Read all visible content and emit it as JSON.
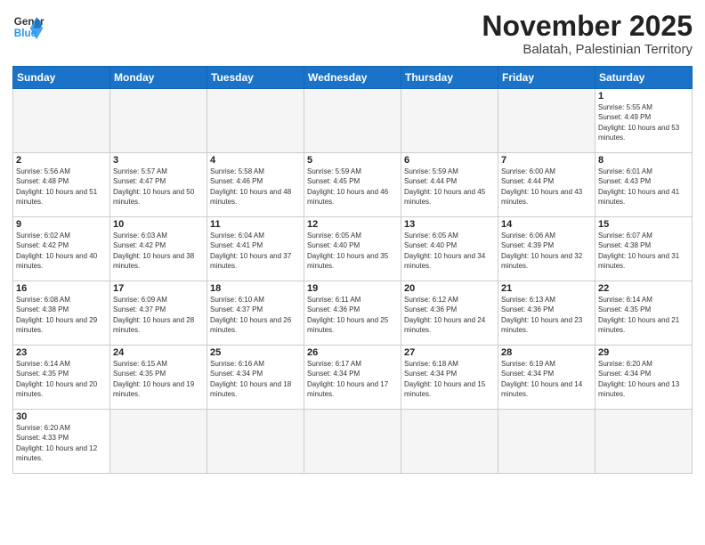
{
  "header": {
    "logo_general": "General",
    "logo_blue": "Blue",
    "month_title": "November 2025",
    "subtitle": "Balatah, Palestinian Territory"
  },
  "weekdays": [
    "Sunday",
    "Monday",
    "Tuesday",
    "Wednesday",
    "Thursday",
    "Friday",
    "Saturday"
  ],
  "days": {
    "1": {
      "sunrise": "5:55 AM",
      "sunset": "4:49 PM",
      "daylight": "10 hours and 53 minutes."
    },
    "2": {
      "sunrise": "5:56 AM",
      "sunset": "4:48 PM",
      "daylight": "10 hours and 51 minutes."
    },
    "3": {
      "sunrise": "5:57 AM",
      "sunset": "4:47 PM",
      "daylight": "10 hours and 50 minutes."
    },
    "4": {
      "sunrise": "5:58 AM",
      "sunset": "4:46 PM",
      "daylight": "10 hours and 48 minutes."
    },
    "5": {
      "sunrise": "5:59 AM",
      "sunset": "4:45 PM",
      "daylight": "10 hours and 46 minutes."
    },
    "6": {
      "sunrise": "5:59 AM",
      "sunset": "4:44 PM",
      "daylight": "10 hours and 45 minutes."
    },
    "7": {
      "sunrise": "6:00 AM",
      "sunset": "4:44 PM",
      "daylight": "10 hours and 43 minutes."
    },
    "8": {
      "sunrise": "6:01 AM",
      "sunset": "4:43 PM",
      "daylight": "10 hours and 41 minutes."
    },
    "9": {
      "sunrise": "6:02 AM",
      "sunset": "4:42 PM",
      "daylight": "10 hours and 40 minutes."
    },
    "10": {
      "sunrise": "6:03 AM",
      "sunset": "4:42 PM",
      "daylight": "10 hours and 38 minutes."
    },
    "11": {
      "sunrise": "6:04 AM",
      "sunset": "4:41 PM",
      "daylight": "10 hours and 37 minutes."
    },
    "12": {
      "sunrise": "6:05 AM",
      "sunset": "4:40 PM",
      "daylight": "10 hours and 35 minutes."
    },
    "13": {
      "sunrise": "6:05 AM",
      "sunset": "4:40 PM",
      "daylight": "10 hours and 34 minutes."
    },
    "14": {
      "sunrise": "6:06 AM",
      "sunset": "4:39 PM",
      "daylight": "10 hours and 32 minutes."
    },
    "15": {
      "sunrise": "6:07 AM",
      "sunset": "4:38 PM",
      "daylight": "10 hours and 31 minutes."
    },
    "16": {
      "sunrise": "6:08 AM",
      "sunset": "4:38 PM",
      "daylight": "10 hours and 29 minutes."
    },
    "17": {
      "sunrise": "6:09 AM",
      "sunset": "4:37 PM",
      "daylight": "10 hours and 28 minutes."
    },
    "18": {
      "sunrise": "6:10 AM",
      "sunset": "4:37 PM",
      "daylight": "10 hours and 26 minutes."
    },
    "19": {
      "sunrise": "6:11 AM",
      "sunset": "4:36 PM",
      "daylight": "10 hours and 25 minutes."
    },
    "20": {
      "sunrise": "6:12 AM",
      "sunset": "4:36 PM",
      "daylight": "10 hours and 24 minutes."
    },
    "21": {
      "sunrise": "6:13 AM",
      "sunset": "4:36 PM",
      "daylight": "10 hours and 23 minutes."
    },
    "22": {
      "sunrise": "6:14 AM",
      "sunset": "4:35 PM",
      "daylight": "10 hours and 21 minutes."
    },
    "23": {
      "sunrise": "6:14 AM",
      "sunset": "4:35 PM",
      "daylight": "10 hours and 20 minutes."
    },
    "24": {
      "sunrise": "6:15 AM",
      "sunset": "4:35 PM",
      "daylight": "10 hours and 19 minutes."
    },
    "25": {
      "sunrise": "6:16 AM",
      "sunset": "4:34 PM",
      "daylight": "10 hours and 18 minutes."
    },
    "26": {
      "sunrise": "6:17 AM",
      "sunset": "4:34 PM",
      "daylight": "10 hours and 17 minutes."
    },
    "27": {
      "sunrise": "6:18 AM",
      "sunset": "4:34 PM",
      "daylight": "10 hours and 15 minutes."
    },
    "28": {
      "sunrise": "6:19 AM",
      "sunset": "4:34 PM",
      "daylight": "10 hours and 14 minutes."
    },
    "29": {
      "sunrise": "6:20 AM",
      "sunset": "4:34 PM",
      "daylight": "10 hours and 13 minutes."
    },
    "30": {
      "sunrise": "6:20 AM",
      "sunset": "4:33 PM",
      "daylight": "10 hours and 12 minutes."
    }
  }
}
